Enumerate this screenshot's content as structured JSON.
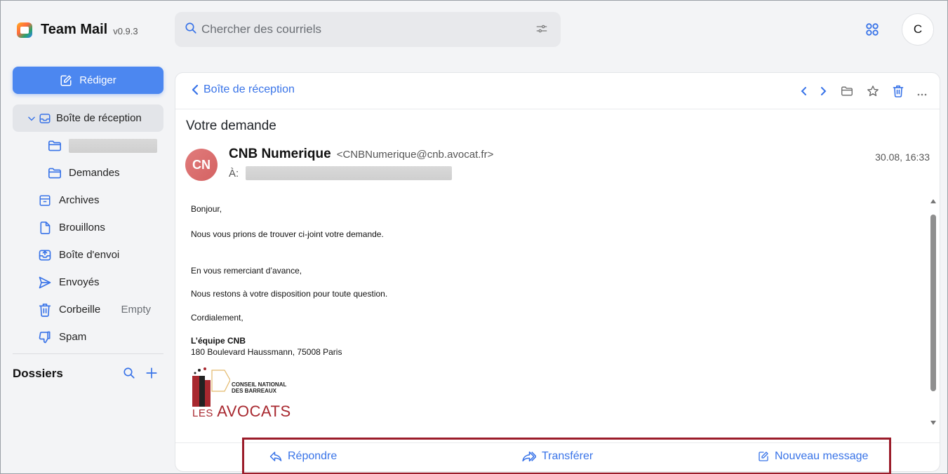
{
  "app": {
    "name": "Team Mail",
    "version": "v0.9.3",
    "user_initial": "C"
  },
  "search": {
    "placeholder": "Chercher des courriels"
  },
  "sidebar": {
    "compose_label": "Rédiger",
    "inbox_label": "Boîte de réception",
    "subfolder_2_label": "Demandes",
    "items": [
      {
        "label": "Archives",
        "icon": "archive-icon"
      },
      {
        "label": "Brouillons",
        "icon": "draft-icon"
      },
      {
        "label": "Boîte d'envoi",
        "icon": "outbox-icon"
      },
      {
        "label": "Envoyés",
        "icon": "send-icon"
      },
      {
        "label": "Corbeille",
        "icon": "trash-icon",
        "extra": "Empty"
      },
      {
        "label": "Spam",
        "icon": "spam-icon"
      }
    ],
    "folders_title": "Dossiers"
  },
  "message": {
    "back_label": "Boîte de réception",
    "subject": "Votre demande",
    "sender_initials": "CN",
    "sender_name": "CNB Numerique",
    "sender_email": "<CNBNumerique@cnb.avocat.fr>",
    "to_label": "À:",
    "date": "30.08, 16:33",
    "body": {
      "greeting": "Bonjour,",
      "line1": "Nous vous prions de trouver ci-joint votre demande.",
      "line2": "En vous remerciant d’avance,",
      "line3": "Nous restons à votre disposition pour toute question.",
      "closing": "Cordialement,",
      "sig_name": "L’équipe CNB",
      "sig_address": "180 Boulevard Haussmann, 75008 Paris"
    },
    "logo": {
      "line1": "CONSEIL NATIONAL",
      "line2": "DES BARREAUX",
      "les": "LES",
      "avocats": "AVOCATS"
    }
  },
  "actions": {
    "reply": "Répondre",
    "forward": "Transférer",
    "new_message": "Nouveau message"
  },
  "colors": {
    "accent": "#3873e8",
    "compose_bg": "#4c87f0",
    "highlight_border": "#9b1c2a",
    "avocats_red": "#a8282f"
  }
}
